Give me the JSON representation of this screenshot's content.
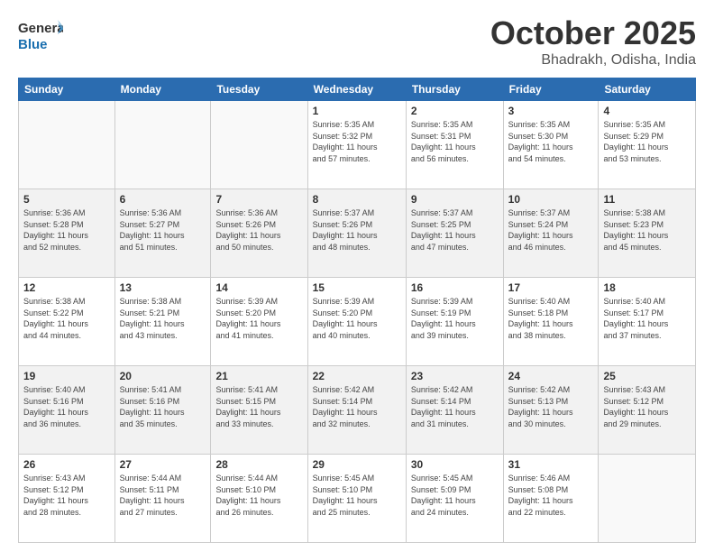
{
  "logo": {
    "line1": "General",
    "line2": "Blue"
  },
  "title": "October 2025",
  "subtitle": "Bhadrakh, Odisha, India",
  "days_of_week": [
    "Sunday",
    "Monday",
    "Tuesday",
    "Wednesday",
    "Thursday",
    "Friday",
    "Saturday"
  ],
  "weeks": [
    [
      {
        "day": "",
        "info": ""
      },
      {
        "day": "",
        "info": ""
      },
      {
        "day": "",
        "info": ""
      },
      {
        "day": "1",
        "info": "Sunrise: 5:35 AM\nSunset: 5:32 PM\nDaylight: 11 hours\nand 57 minutes."
      },
      {
        "day": "2",
        "info": "Sunrise: 5:35 AM\nSunset: 5:31 PM\nDaylight: 11 hours\nand 56 minutes."
      },
      {
        "day": "3",
        "info": "Sunrise: 5:35 AM\nSunset: 5:30 PM\nDaylight: 11 hours\nand 54 minutes."
      },
      {
        "day": "4",
        "info": "Sunrise: 5:35 AM\nSunset: 5:29 PM\nDaylight: 11 hours\nand 53 minutes."
      }
    ],
    [
      {
        "day": "5",
        "info": "Sunrise: 5:36 AM\nSunset: 5:28 PM\nDaylight: 11 hours\nand 52 minutes."
      },
      {
        "day": "6",
        "info": "Sunrise: 5:36 AM\nSunset: 5:27 PM\nDaylight: 11 hours\nand 51 minutes."
      },
      {
        "day": "7",
        "info": "Sunrise: 5:36 AM\nSunset: 5:26 PM\nDaylight: 11 hours\nand 50 minutes."
      },
      {
        "day": "8",
        "info": "Sunrise: 5:37 AM\nSunset: 5:26 PM\nDaylight: 11 hours\nand 48 minutes."
      },
      {
        "day": "9",
        "info": "Sunrise: 5:37 AM\nSunset: 5:25 PM\nDaylight: 11 hours\nand 47 minutes."
      },
      {
        "day": "10",
        "info": "Sunrise: 5:37 AM\nSunset: 5:24 PM\nDaylight: 11 hours\nand 46 minutes."
      },
      {
        "day": "11",
        "info": "Sunrise: 5:38 AM\nSunset: 5:23 PM\nDaylight: 11 hours\nand 45 minutes."
      }
    ],
    [
      {
        "day": "12",
        "info": "Sunrise: 5:38 AM\nSunset: 5:22 PM\nDaylight: 11 hours\nand 44 minutes."
      },
      {
        "day": "13",
        "info": "Sunrise: 5:38 AM\nSunset: 5:21 PM\nDaylight: 11 hours\nand 43 minutes."
      },
      {
        "day": "14",
        "info": "Sunrise: 5:39 AM\nSunset: 5:20 PM\nDaylight: 11 hours\nand 41 minutes."
      },
      {
        "day": "15",
        "info": "Sunrise: 5:39 AM\nSunset: 5:20 PM\nDaylight: 11 hours\nand 40 minutes."
      },
      {
        "day": "16",
        "info": "Sunrise: 5:39 AM\nSunset: 5:19 PM\nDaylight: 11 hours\nand 39 minutes."
      },
      {
        "day": "17",
        "info": "Sunrise: 5:40 AM\nSunset: 5:18 PM\nDaylight: 11 hours\nand 38 minutes."
      },
      {
        "day": "18",
        "info": "Sunrise: 5:40 AM\nSunset: 5:17 PM\nDaylight: 11 hours\nand 37 minutes."
      }
    ],
    [
      {
        "day": "19",
        "info": "Sunrise: 5:40 AM\nSunset: 5:16 PM\nDaylight: 11 hours\nand 36 minutes."
      },
      {
        "day": "20",
        "info": "Sunrise: 5:41 AM\nSunset: 5:16 PM\nDaylight: 11 hours\nand 35 minutes."
      },
      {
        "day": "21",
        "info": "Sunrise: 5:41 AM\nSunset: 5:15 PM\nDaylight: 11 hours\nand 33 minutes."
      },
      {
        "day": "22",
        "info": "Sunrise: 5:42 AM\nSunset: 5:14 PM\nDaylight: 11 hours\nand 32 minutes."
      },
      {
        "day": "23",
        "info": "Sunrise: 5:42 AM\nSunset: 5:14 PM\nDaylight: 11 hours\nand 31 minutes."
      },
      {
        "day": "24",
        "info": "Sunrise: 5:42 AM\nSunset: 5:13 PM\nDaylight: 11 hours\nand 30 minutes."
      },
      {
        "day": "25",
        "info": "Sunrise: 5:43 AM\nSunset: 5:12 PM\nDaylight: 11 hours\nand 29 minutes."
      }
    ],
    [
      {
        "day": "26",
        "info": "Sunrise: 5:43 AM\nSunset: 5:12 PM\nDaylight: 11 hours\nand 28 minutes."
      },
      {
        "day": "27",
        "info": "Sunrise: 5:44 AM\nSunset: 5:11 PM\nDaylight: 11 hours\nand 27 minutes."
      },
      {
        "day": "28",
        "info": "Sunrise: 5:44 AM\nSunset: 5:10 PM\nDaylight: 11 hours\nand 26 minutes."
      },
      {
        "day": "29",
        "info": "Sunrise: 5:45 AM\nSunset: 5:10 PM\nDaylight: 11 hours\nand 25 minutes."
      },
      {
        "day": "30",
        "info": "Sunrise: 5:45 AM\nSunset: 5:09 PM\nDaylight: 11 hours\nand 24 minutes."
      },
      {
        "day": "31",
        "info": "Sunrise: 5:46 AM\nSunset: 5:08 PM\nDaylight: 11 hours\nand 22 minutes."
      },
      {
        "day": "",
        "info": ""
      }
    ]
  ]
}
